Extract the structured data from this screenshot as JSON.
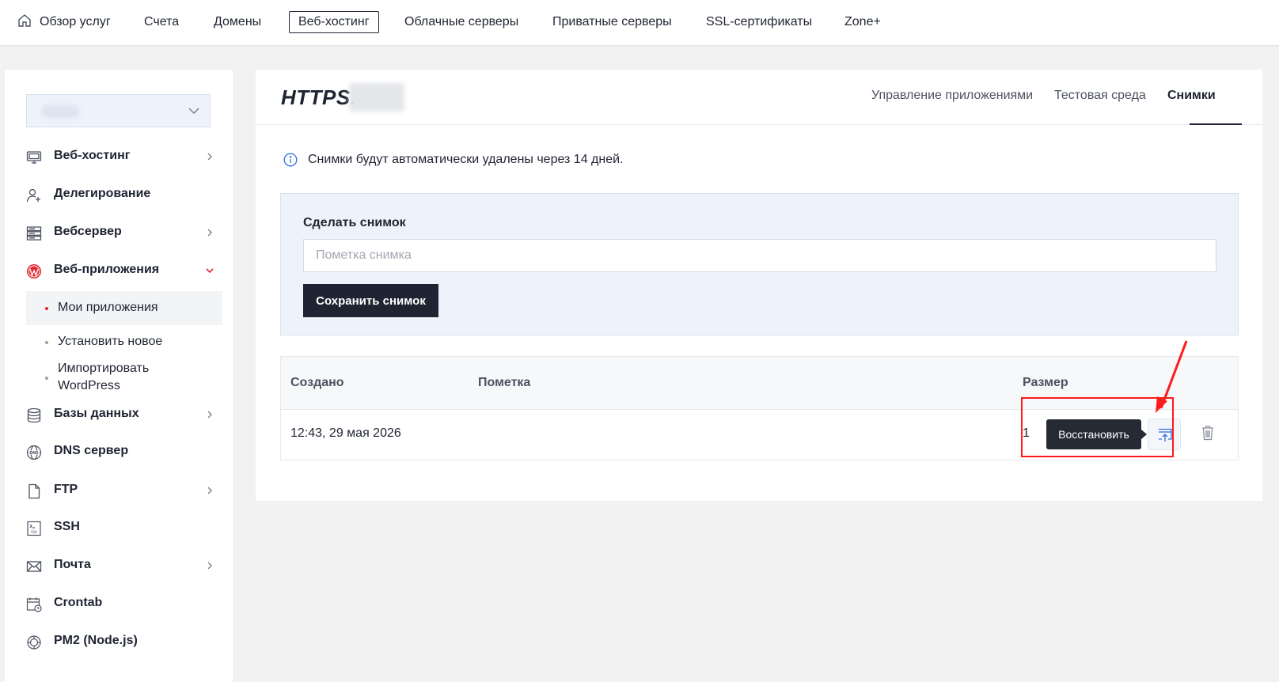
{
  "topnav": {
    "items": [
      {
        "label": "Обзор услуг"
      },
      {
        "label": "Счета"
      },
      {
        "label": "Домены"
      },
      {
        "label": "Веб-хостинг"
      },
      {
        "label": "Облачные серверы"
      },
      {
        "label": "Приватные серверы"
      },
      {
        "label": "SSL-сертификаты"
      },
      {
        "label": "Zone+"
      }
    ],
    "active_index": 3
  },
  "sidebar": {
    "items": [
      {
        "label": "Веб-хостинг",
        "icon": "monitor-icon"
      },
      {
        "label": "Делегирование",
        "icon": "user-plus-icon"
      },
      {
        "label": "Вебсервер",
        "icon": "server-icon"
      },
      {
        "label": "Веб-приложения",
        "icon": "wordpress-icon"
      },
      {
        "label": "Базы данных",
        "icon": "database-icon"
      },
      {
        "label": "DNS сервер",
        "icon": "dns-icon"
      },
      {
        "label": "FTP",
        "icon": "file-icon"
      },
      {
        "label": "SSH",
        "icon": "terminal-icon"
      },
      {
        "label": "Почта",
        "icon": "mail-icon"
      },
      {
        "label": "Crontab",
        "icon": "calendar-icon"
      },
      {
        "label": "PM2 (Node.js)",
        "icon": "nodejs-icon"
      }
    ],
    "subitems": [
      {
        "label": "Мои приложения"
      },
      {
        "label": "Установить новое"
      },
      {
        "label": "Импортировать WordPress"
      }
    ]
  },
  "main": {
    "title": "HTTPS://",
    "tabs": [
      {
        "label": "Управление приложениями"
      },
      {
        "label": "Тестовая среда"
      },
      {
        "label": "Снимки"
      }
    ],
    "active_tab": 2,
    "info_text": "Снимки будут автоматически удалены через 14 дней.",
    "snapshot": {
      "heading": "Сделать снимок",
      "placeholder": "Пометка снимка",
      "value": "",
      "save_label": "Сохранить снимок"
    },
    "table": {
      "headers": [
        "Создано",
        "Пометка",
        "Размер"
      ],
      "rows": [
        {
          "created": "12:43, 29 мая 2026",
          "note": "",
          "size": "1"
        }
      ],
      "tooltip": "Восстановить"
    }
  },
  "colors": {
    "accent_dark": "#1f2432",
    "highlight": "#ff1a1a",
    "panel_bg": "#eef2fb",
    "active_dot": "#e3262f"
  }
}
